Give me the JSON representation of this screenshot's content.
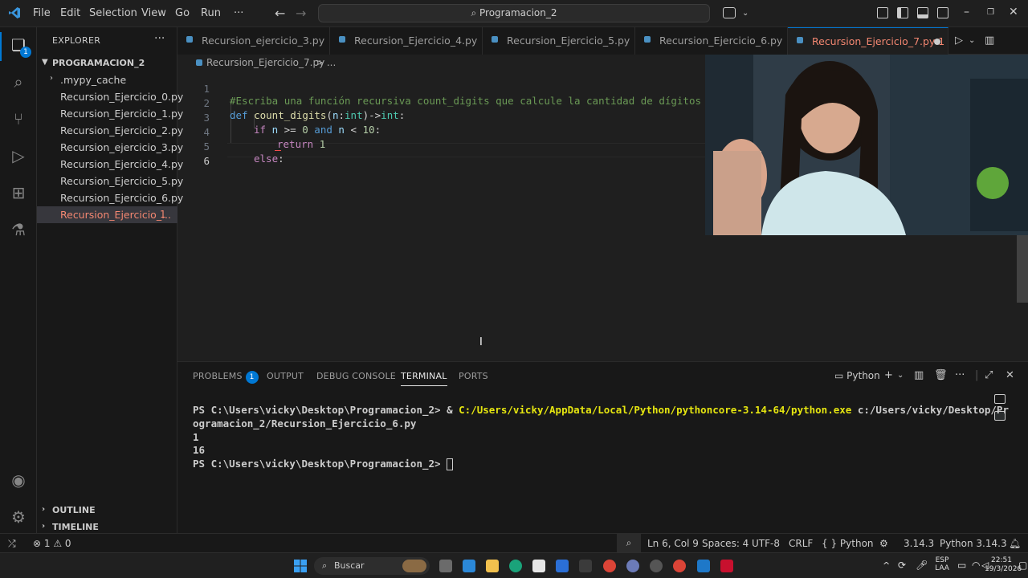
{
  "window": {
    "search_title": "Programacion_2",
    "menu": [
      "File",
      "Edit",
      "Selection",
      "View",
      "Go",
      "Run",
      "···"
    ]
  },
  "activity_bar": {
    "explorer_badge": "1"
  },
  "sidebar": {
    "header": "EXPLORER",
    "more": "···",
    "root": "PROGRAMACION_2",
    "items": [
      {
        "label": ".mypy_cache"
      },
      {
        "label": "Recursion_Ejercicio_0.py"
      },
      {
        "label": "Recursion_Ejercicio_1.py"
      },
      {
        "label": "Recursion_Ejercicio_2.py"
      },
      {
        "label": "Recursion_ejercicio_3.py"
      },
      {
        "label": "Recursion_Ejercicio_4.py"
      },
      {
        "label": "Recursion_Ejercicio_5.py"
      },
      {
        "label": "Recursion_Ejercicio_6.py"
      },
      {
        "label": "Recursion_Ejercicio_...",
        "badge": "1"
      }
    ],
    "outline": "OUTLINE",
    "timeline": "TIMELINE"
  },
  "tabs": [
    {
      "label": "Recursion_ejercicio_3.py"
    },
    {
      "label": "Recursion_Ejercicio_4.py"
    },
    {
      "label": "Recursion_Ejercicio_5.py"
    },
    {
      "label": "Recursion_Ejercicio_6.py"
    },
    {
      "label": "Recursion_Ejercicio_7.py 1"
    }
  ],
  "breadcrumb": {
    "file": "Recursion_Ejercicio_7.py",
    "sep": "> ..."
  },
  "editor": {
    "line_numbers": [
      "1",
      "2",
      "3",
      "4",
      "5",
      "6"
    ],
    "l1_comment": "#Escriba una función recursiva count_digits que calcule la cantidad de dígitos d",
    "l2_def": "def",
    "l2_fn": "count_digits",
    "l2_p1": "(",
    "l2_n": "n",
    "l2_colon": ":",
    "l2_int": "int",
    "l2_arrow": ")->",
    "l2_ret": "int",
    "l2_end": ":",
    "l3_if": "if",
    "l3_n1": "n",
    "l3_ge": " >= ",
    "l3_zero": "0",
    "l3_and": "and",
    "l3_n2": "n",
    "l3_lt": " < ",
    "l3_ten": "10",
    "l3_end": ":",
    "l4_return": "return",
    "l4_one": "1",
    "l5_else": "else",
    "l5_end": ":"
  },
  "panel": {
    "tabs": [
      "PROBLEMS",
      "OUTPUT",
      "DEBUG CONSOLE",
      "TERMINAL",
      "PORTS"
    ],
    "problems_badge": "1",
    "shell": "Python",
    "terminal": {
      "l1_prompt": "PS C:\\Users\\vicky\\Desktop\\Programacion_2> & ",
      "l1_exe": "C:/Users/vicky/AppData/Local/Python/pythoncore-3.14-64/python.exe",
      "l1_arg": " c:/Users/vicky/Desktop/Pr",
      "l2": "ogramacion_2/Recursion_Ejercicio_6.py",
      "l3": "1",
      "l4": "16",
      "l5_prompt": "PS C:\\Users\\vicky\\Desktop\\Programacion_2> "
    }
  },
  "statusbar": {
    "problems_errors": "1",
    "problems_warnings": "0",
    "position": "Ln 6, Col 9",
    "spaces": "Spaces: 4",
    "encoding": "UTF-8",
    "eol": "CRLF",
    "language": "Python",
    "language_braces": "{ }",
    "python_version": "3.14.3",
    "interpreter": "Python 3.14.3"
  },
  "taskbar": {
    "search": "Buscar",
    "lang_top": "ESP",
    "lang_bottom": "LAA",
    "time": "22:51",
    "date": "19/3/2026"
  },
  "colors": {
    "accent": "#0078d4",
    "error_file": "#f48771"
  }
}
